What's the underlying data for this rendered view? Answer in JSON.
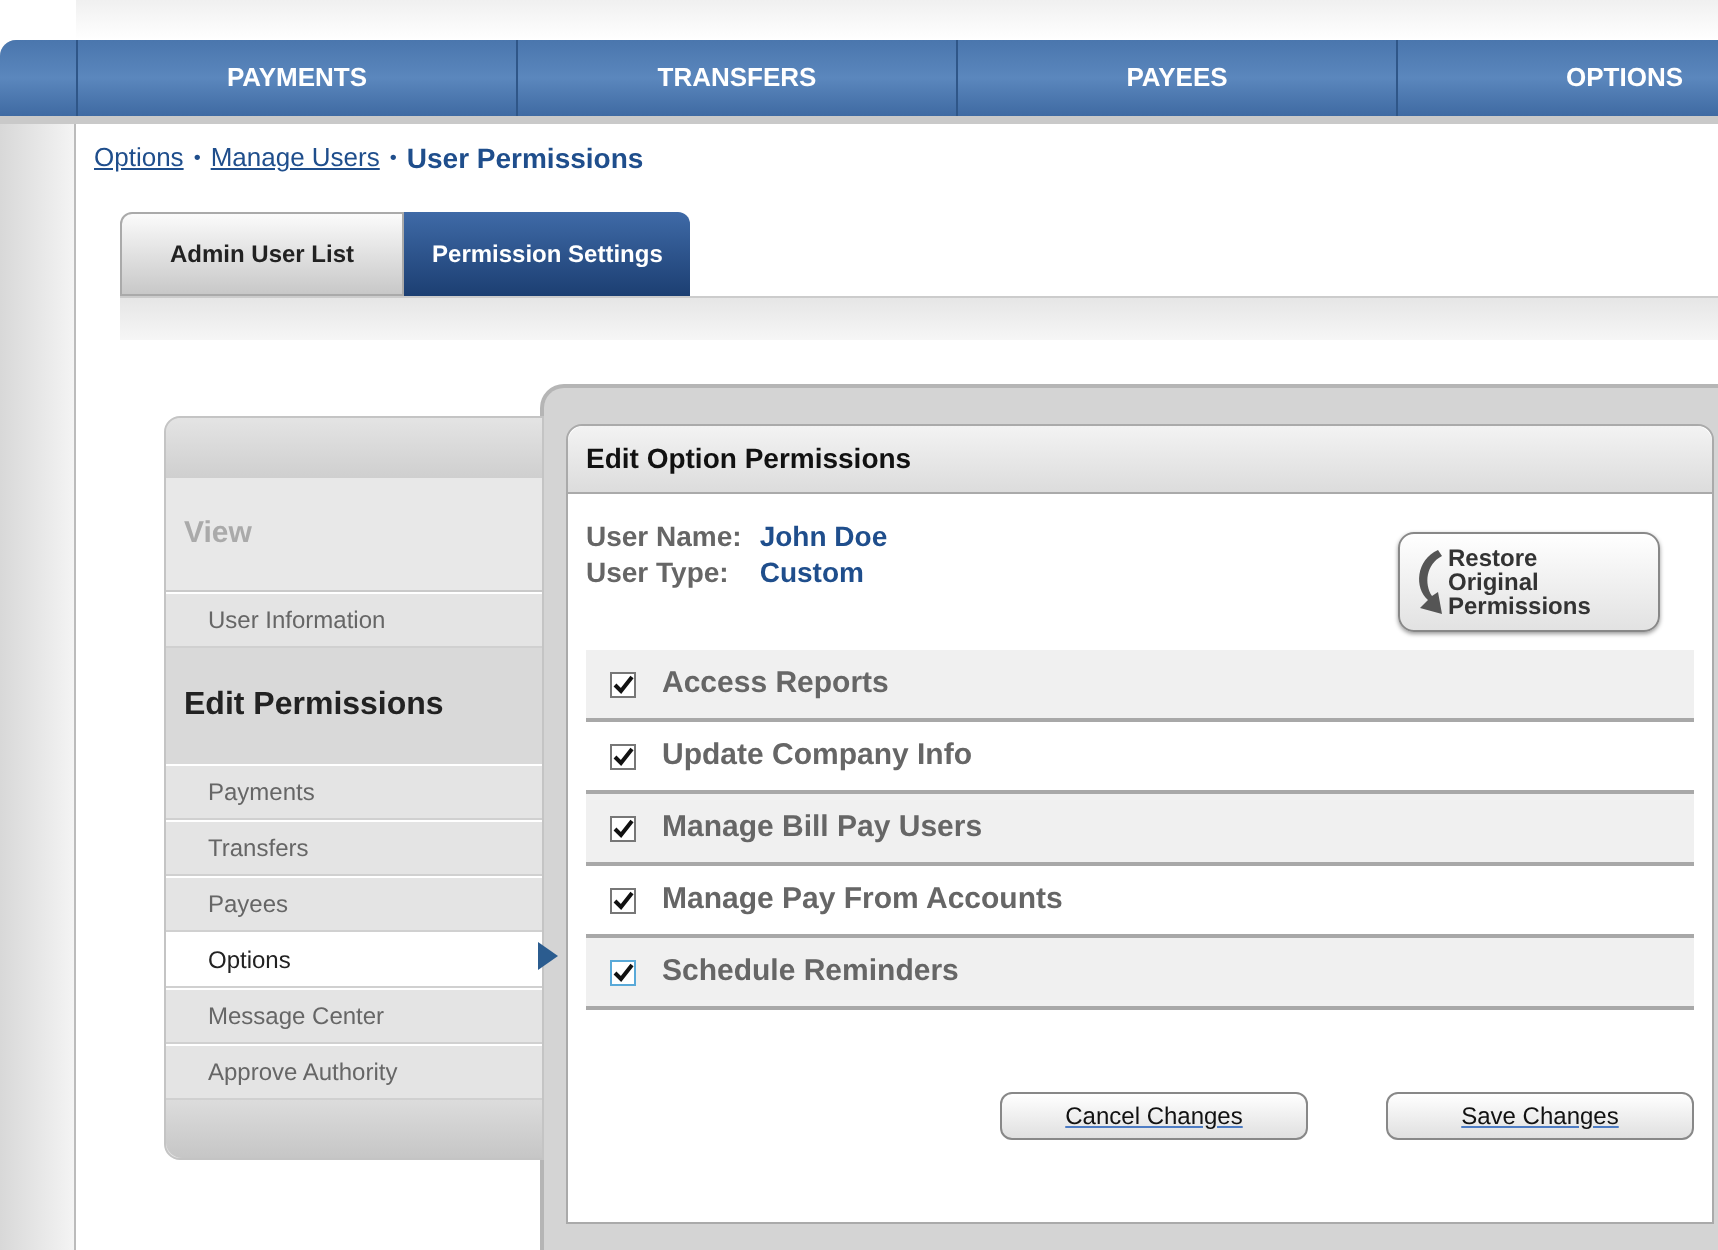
{
  "nav": [
    {
      "label": "PAYMENTS"
    },
    {
      "label": "TRANSFERS"
    },
    {
      "label": "PAYEES"
    },
    {
      "label": "OPTIONS"
    }
  ],
  "breadcrumb": [
    {
      "kind": "link",
      "label": "Options"
    },
    {
      "kind": "separator",
      "label": "•"
    },
    {
      "kind": "link",
      "label": "Manage Users"
    },
    {
      "kind": "separator",
      "label": "•"
    },
    {
      "kind": "current",
      "label": "User Permissions"
    }
  ],
  "tabs": [
    {
      "label": "Admin User List",
      "selected": false
    },
    {
      "label": "Permission Settings",
      "selected": true
    }
  ],
  "sidebar": [
    {
      "kind": "header",
      "label": "View",
      "active": false
    },
    {
      "kind": "item",
      "label": "User Information",
      "selected": false
    },
    {
      "kind": "header",
      "label": "Edit Permissions",
      "active": true
    },
    {
      "kind": "item",
      "label": "Payments",
      "selected": false
    },
    {
      "kind": "item",
      "label": "Transfers",
      "selected": false
    },
    {
      "kind": "item",
      "label": "Payees",
      "selected": false
    },
    {
      "kind": "item",
      "label": "Options",
      "selected": true
    },
    {
      "kind": "item",
      "label": "Message Center",
      "selected": false
    },
    {
      "kind": "item",
      "label": "Approve Authority",
      "selected": false
    }
  ],
  "panel": {
    "title": "Edit Option Permissions",
    "fields": [
      {
        "label": "User Name:",
        "value": "John Doe"
      },
      {
        "label": "User Type:",
        "value": "Custom"
      }
    ],
    "restore_button": "Restore Original Permissions",
    "permissions": [
      {
        "label": "Access Reports",
        "checked": true
      },
      {
        "label": "Update Company Info",
        "checked": true
      },
      {
        "label": "Manage Bill Pay Users",
        "checked": true
      },
      {
        "label": "Manage Pay From Accounts",
        "checked": true
      },
      {
        "label": "Schedule Reminders",
        "checked": true
      }
    ],
    "buttons": [
      "Cancel Changes",
      "Save Changes"
    ]
  }
}
